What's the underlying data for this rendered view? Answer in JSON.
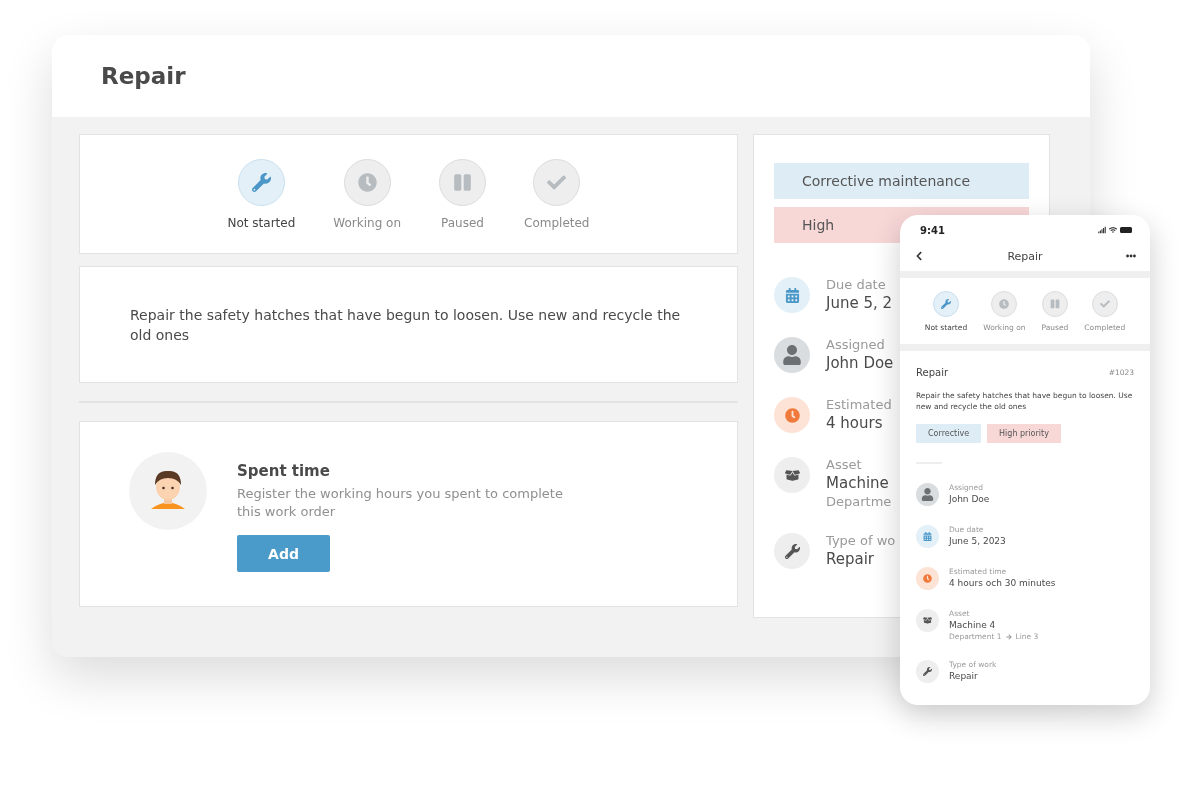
{
  "desktop": {
    "title": "Repair",
    "statuses": [
      {
        "label": "Not started",
        "selected": true,
        "kind": "wrench"
      },
      {
        "label": "Working on",
        "selected": false,
        "kind": "clock"
      },
      {
        "label": "Paused",
        "selected": false,
        "kind": "pause"
      },
      {
        "label": "Completed",
        "selected": false,
        "kind": "check"
      }
    ],
    "description": "Repair the safety hatches that have begun to loosen. Use new and recycle the old ones",
    "spent_time": {
      "title": "Spent time",
      "text": "Register the working hours you spent to complete this work order",
      "button": "Add"
    },
    "tags": [
      {
        "label": "Corrective maintenance",
        "kind": "corrective"
      },
      {
        "label": "High",
        "kind": "priority"
      }
    ],
    "details": [
      {
        "kind": "calendar",
        "label": "Due date",
        "value": "June 5, 2"
      },
      {
        "kind": "avatar",
        "label": "Assigned",
        "value": "John Doe"
      },
      {
        "kind": "clock",
        "label": "Estimated",
        "value": "4 hours"
      },
      {
        "kind": "asset",
        "label": "Asset",
        "value": "Machine",
        "sub": "Departme"
      },
      {
        "kind": "wrench",
        "label": "Type of wo",
        "value": "Repair"
      }
    ]
  },
  "phone": {
    "time": "9:41",
    "title": "Repair",
    "statuses": [
      {
        "label": "Not started",
        "selected": true,
        "kind": "wrench"
      },
      {
        "label": "Working on",
        "selected": false,
        "kind": "clock"
      },
      {
        "label": "Paused",
        "selected": false,
        "kind": "pause"
      },
      {
        "label": "Completed",
        "selected": false,
        "kind": "check"
      }
    ],
    "card_title": "Repair",
    "number": "#1023",
    "description": "Repair the safety hatches that have begun to loosen. Use new and recycle the old ones",
    "tags": [
      {
        "label": "Corrective",
        "kind": "corrective"
      },
      {
        "label": "High priority",
        "kind": "priority"
      }
    ],
    "details": [
      {
        "kind": "avatar",
        "label": "Assigned",
        "value": "John Doe"
      },
      {
        "kind": "calendar",
        "label": "Due date",
        "value": "June 5, 2023"
      },
      {
        "kind": "clock",
        "label": "Estimated time",
        "value": "4 hours och 30 minutes"
      },
      {
        "kind": "asset",
        "label": "Asset",
        "value": "Machine 4",
        "path": [
          "Department 1",
          "Line 3"
        ]
      },
      {
        "kind": "wrench",
        "label": "Type of work",
        "value": "Repair"
      }
    ]
  }
}
